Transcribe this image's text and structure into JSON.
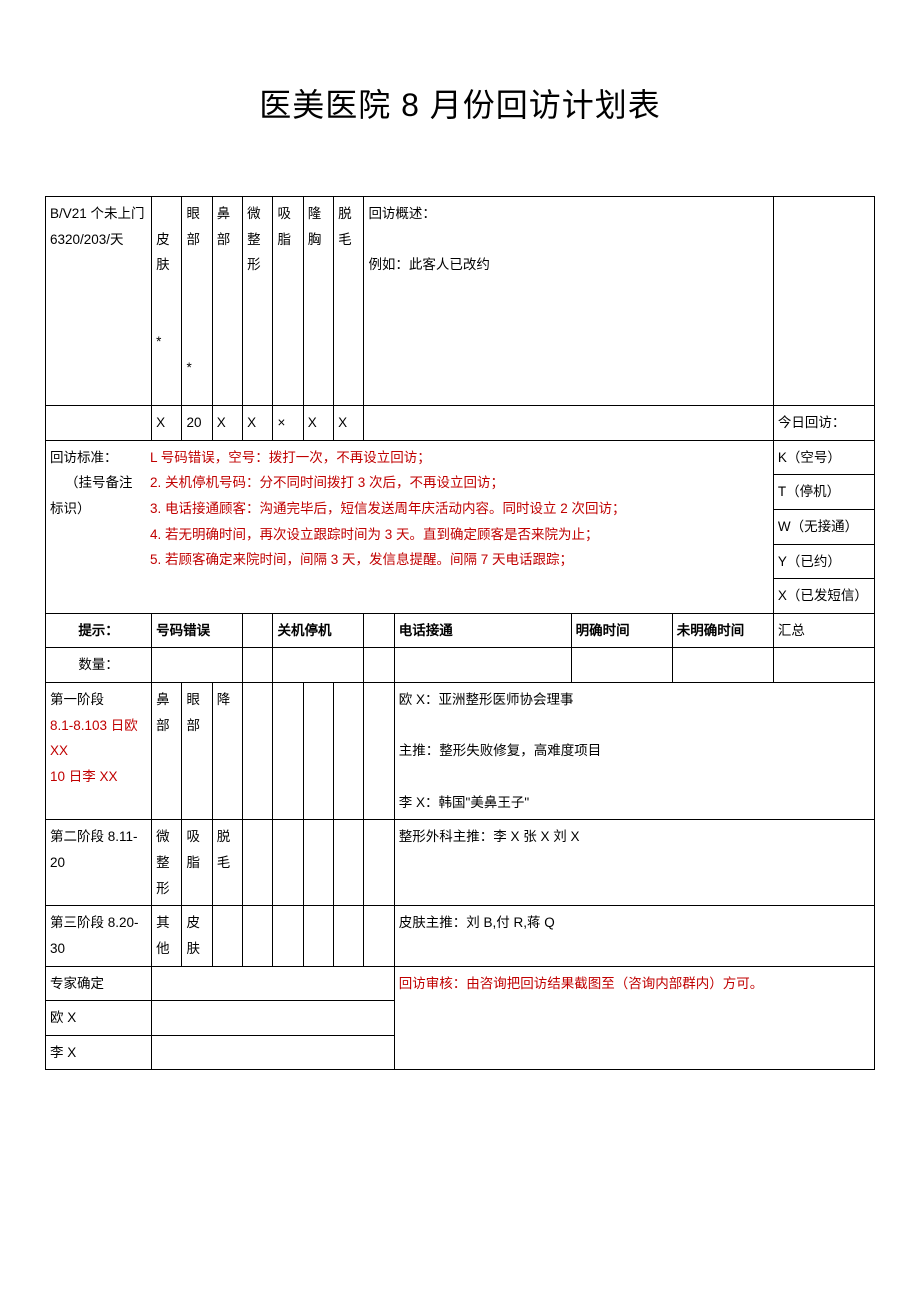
{
  "title": "医美医院 8 月份回访计划表",
  "row1": {
    "col1_line1": "B/V21 个未上门",
    "col1_line2": "6320/203/天",
    "col2": "皮肤",
    "col3": "眼部",
    "col4": "鼻部",
    "col5": "微整形",
    "col6": "吸脂",
    "col7": "隆胸",
    "col8": "脱毛",
    "desc1": "回访概述：",
    "desc2": "例如：此客人已改约",
    "star1": "*",
    "star2": "*"
  },
  "row2": {
    "c1": "X",
    "c2": "20",
    "c3": "X",
    "c4": "X",
    "c5": "×",
    "c6": "X",
    "c7": "X",
    "legend_title": "今日回访："
  },
  "standards": {
    "left1": "回访标准：",
    "left2": "（挂号备注",
    "left3": "标识）",
    "r1": "L 号码错误，空号：拨打一次，不再设立回访；",
    "r2": "2. 关机停机号码：分不同时间拨打 3 次后，不再设立回访；",
    "r3": "3. 电话接通顾客：沟通完毕后，短信发送周年庆活动内容。同时设立 2 次回访；",
    "r4": "4. 若无明确时间，再次设立跟踪时间为 3 天。直到确定顾客是否来院为止；",
    "r5": "5. 若顾客确定来院时间，间隔 3 天，发信息提醒。间隔 7 天电话跟踪；",
    "legend_k": "K（空号）",
    "legend_t": "T（停机）",
    "legend_w": "W（无接通）",
    "legend_y": "Y（已约）",
    "legend_x": "X（已发短信）"
  },
  "headers": {
    "tip": "提示：",
    "wrong": "号码错误",
    "off": "关机停机",
    "ok": "电话接通",
    "clear": "明确时间",
    "unclear": "未明确时间",
    "sum": "汇总"
  },
  "qty": "数量：",
  "stage1": {
    "t1": "第一阶段",
    "t2": "8.1-8.103 日欧",
    "t3": "XX",
    "t4": "10 日李 XX",
    "c1": "鼻部",
    "c2": "眼部",
    "c3": "降",
    "d1": "欧 X：亚洲整形医师协会理事",
    "d2": "主推：整形失败修复，高难度项目",
    "d3": "李 X：韩国\"美鼻王子\""
  },
  "stage2": {
    "t1": "第二阶段 8.11-",
    "t2": "20",
    "c1": "微整形",
    "c2": "吸脂",
    "c3": "脱毛",
    "d1": "整形外科主推：李 X 张 X 刘 X"
  },
  "stage3": {
    "t1": "第三阶段 8.20-",
    "t2": "30",
    "c1": "其他",
    "c2": "皮肤",
    "d1": "皮肤主推：刘 B,付 R,蒋 Q"
  },
  "expert": {
    "label": "专家确定",
    "ou": "欧 X",
    "li": "李 X",
    "audit": "回访审核：由咨询把回访结果截图至（咨询内部群内）方可。"
  }
}
